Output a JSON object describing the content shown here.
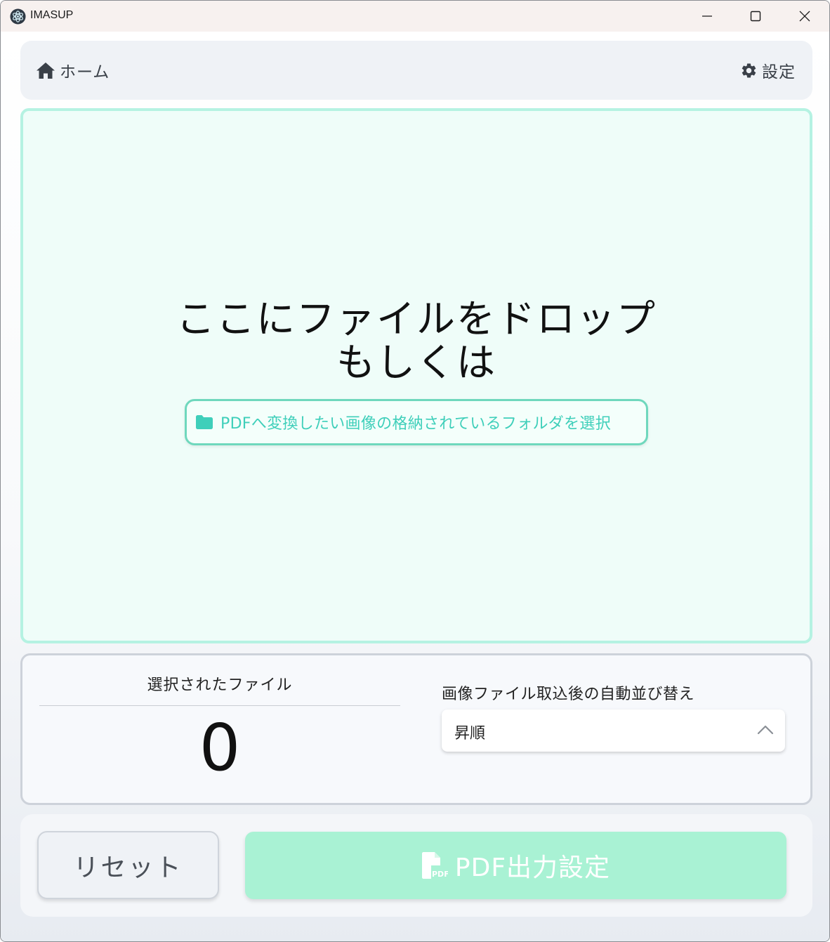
{
  "window": {
    "title": "IMASUP",
    "controls": {
      "minimize": "minimize",
      "maximize": "maximize",
      "close": "close"
    }
  },
  "nav": {
    "home_label": "ホーム",
    "settings_label": "設定"
  },
  "dropzone": {
    "line1": "ここにファイルをドロップ",
    "line2": "もしくは",
    "folder_button_label": "PDFへ変換したい画像の格納されているフォルダを選択"
  },
  "selection": {
    "title": "選択されたファイル",
    "count": "0"
  },
  "sort": {
    "title": "画像ファイル取込後の自動並び替え",
    "selected_value": "昇順"
  },
  "actions": {
    "reset_label": "リセット",
    "pdf_label": "PDF出力設定"
  },
  "colors": {
    "accent": "#3fcfba",
    "dropzone_bg": "#effdf9",
    "dropzone_border": "#b5f2e2",
    "pdf_button_bg": "#a9f2d4"
  }
}
